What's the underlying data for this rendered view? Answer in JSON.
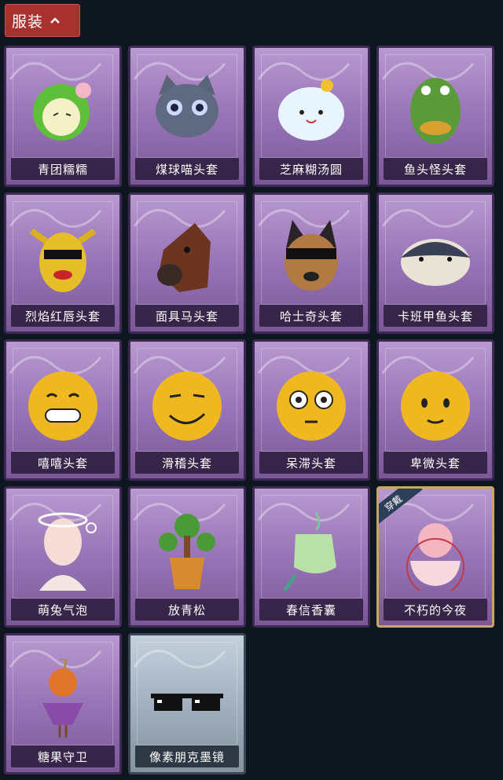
{
  "section": {
    "label": "服装"
  },
  "items": [
    {
      "name": "青团糯糯",
      "icon": "green-dumpling-hat-icon"
    },
    {
      "name": "煤球喵头套",
      "icon": "cat-head-mask-icon"
    },
    {
      "name": "芝麻糊汤圆",
      "icon": "rice-ball-hat-icon"
    },
    {
      "name": "鱼头怪头套",
      "icon": "fish-head-mask-icon"
    },
    {
      "name": "烈焰红唇头套",
      "icon": "yellow-creature-mask-icon"
    },
    {
      "name": "面具马头套",
      "icon": "horse-head-mask-icon"
    },
    {
      "name": "哈士奇头套",
      "icon": "husky-head-mask-icon"
    },
    {
      "name": "卡班甲鱼头套",
      "icon": "turtle-head-mask-icon"
    },
    {
      "name": "嘻嘻头套",
      "icon": "grin-emoji-mask-icon"
    },
    {
      "name": "滑稽头套",
      "icon": "smirk-emoji-mask-icon"
    },
    {
      "name": "呆滞头套",
      "icon": "blank-stare-emoji-mask-icon"
    },
    {
      "name": "卑微头套",
      "icon": "timid-emoji-mask-icon"
    },
    {
      "name": "萌兔气泡",
      "icon": "bunny-bubble-icon"
    },
    {
      "name": "放青松",
      "icon": "potted-pine-icon"
    },
    {
      "name": "春信香囊",
      "icon": "sachet-icon"
    },
    {
      "name": "不朽的今夜",
      "icon": "fox-teacup-icon",
      "badge": "穿戴"
    },
    {
      "name": "糖果守卫",
      "icon": "pumpkin-scarecrow-icon"
    },
    {
      "name": "像素朋克墨镜",
      "icon": "pixel-sunglasses-icon"
    }
  ]
}
